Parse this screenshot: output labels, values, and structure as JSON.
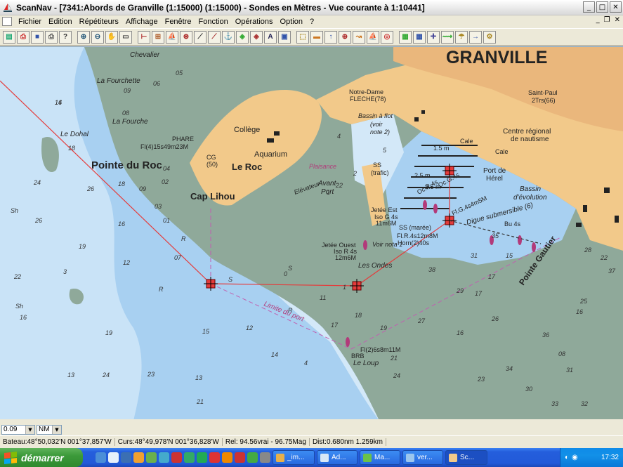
{
  "window": {
    "title": "ScanNav - [7341:Abords de Granville (1:15000) (1:15000) - Sondes en  Mètres  - Vue courante à 1:10441]"
  },
  "window_buttons": [
    "_",
    "□",
    "✕"
  ],
  "menu": [
    "Fichier",
    "Edition",
    "Répétiteurs",
    "Affichage",
    "Fenêtre",
    "Fonction",
    "Opérations",
    "Option",
    "?"
  ],
  "mdi_buttons": [
    "_",
    "❐",
    "✕"
  ],
  "toolbar": [
    "open-icon",
    "print-icon",
    "save-icon",
    "printer-icon",
    "help-pointer-icon",
    "zoom-in-icon",
    "zoom-out-icon",
    "pan-hand-icon",
    "select-rect-icon",
    "ruler-icon",
    "zoom-area-icon",
    "boat-icon",
    "target-icon",
    "route-icon",
    "edit-route-icon",
    "anchor-icon",
    "mark-icon",
    "mark-edit-icon",
    "text-icon",
    "layers-icon",
    "gps-icon",
    "nmea-icon",
    "up-arrow-icon",
    "compass-icon",
    "route-follow-icon",
    "boat-mark-icon",
    "lifebuoy-icon",
    "chart-index-icon",
    "chart-grid-icon",
    "position-icon",
    "track-icon",
    "weather-icon",
    "arrow-right-icon",
    "autopilot-icon"
  ],
  "chart": {
    "place_labels": {
      "granville": "GRANVILLE",
      "pointe_du_roc": "Pointe du Roc",
      "cap_lihou": "Cap Lihou",
      "le_roc": "Le Roc",
      "college": "Collège",
      "aquarium": "Aquarium",
      "pointe_gautier": "Pointe Gautier",
      "la_fourchette": "La Fourchette",
      "la_fourche": "La Fourche",
      "chevalier": "Chevalier",
      "le_dohal": "Le Dohal",
      "les_ondes": "Les Ondes",
      "le_loup": "Le Loup",
      "notre_dame": "Notre-Dame",
      "fleche": "FLECHE(78)",
      "saint_paul": "Saint-Paul",
      "saint_paul_2": "2Trs(66)",
      "centre_regional": "Centre régional",
      "de_nautisme": "de nautisme",
      "port_herel": "Port de",
      "port_herel_2": "Hérel",
      "bassin_evolution": "Bassin",
      "bassin_evolution_2": "d'évolution",
      "digue": "Digue submersible (6)",
      "plaisance": "Plaisance",
      "avant_port": "Avant-",
      "avant_port_2": "Port",
      "bassin_a_flot": "Bassin à flot",
      "voir_note": "(voir",
      "voir_note_2": "note 2)",
      "limite_port": "Limite du port",
      "voir_nota": "Voir nota 1",
      "elevateur": "Elévateur",
      "cale": "Cale",
      "cale_2": "Cale",
      "ss_trafic": "SS",
      "ss_trafic_2": "(trafic)",
      "ss_maree": "SS (marée)",
      "phare": "PHARE",
      "cg": "CG",
      "cg_50": "(50)",
      "brb": "BRB"
    },
    "light_labels": {
      "phare_light": "Fl(4)15s49m23M",
      "jetee_est": "Jetée Est",
      "jetee_est_2": "Iso G 4s",
      "jetee_est_3": "11m6M",
      "jetee_ouest": "Jetée Ouest",
      "jetee_ouest_2": "Iso R 4s",
      "jetee_ouest_3": "12m6M",
      "digue_light": "Fl.R.4s12m8M",
      "horn": "Horn(2)40s",
      "flg": "Fl.G.4s4m5M",
      "loup_light": "Fl(2)6s8m11M",
      "oc_r": "Oc.R.4s",
      "oc_g": "Oc.G.4s",
      "bu": "Bu 4s",
      "len_25a": "2.5 m",
      "len_25b": "2.5 m",
      "len_15": "1.5 m"
    },
    "soundings": [
      "16",
      "18",
      "26",
      "24",
      "26",
      "19",
      "16",
      "18",
      "12",
      "16",
      "19",
      "01",
      "09",
      "07",
      "22",
      "24",
      "23",
      "13",
      "4",
      "5",
      "2",
      "1",
      "09",
      "08",
      "06",
      "05",
      "04",
      "02",
      "03",
      "0",
      "3",
      "4",
      "1",
      "15",
      "14",
      "12",
      "11",
      "13",
      "21",
      "23",
      "24",
      "22",
      "21",
      "17",
      "16",
      "17",
      "15",
      "26",
      "16",
      "22",
      "25",
      "08",
      "32",
      "33",
      "31",
      "30",
      "34",
      "36",
      "37",
      "35",
      "38",
      "31",
      "29",
      "28",
      "27",
      "19",
      "18",
      "17",
      "14"
    ],
    "seabed_marks": [
      "Sh",
      "Sh",
      "R",
      "S",
      "R",
      "R",
      "S"
    ]
  },
  "controls": {
    "scale_value": "0.09",
    "units_value": "NM"
  },
  "status": {
    "bateau": "Bateau:48°50,032'N 001°37,857'W",
    "curseur": "Curs:48°49,978'N 001°36,828'W",
    "relevement": "Rel: 94.56vrai - 96.75Mag",
    "distance": "Dist:0.680nm  1.259km"
  },
  "taskbar": {
    "start_label": "démarrer",
    "tasks": [
      "_im...",
      "Ad...",
      "Ma...",
      "ver...",
      "Sc..."
    ],
    "clock": "17:32"
  },
  "colors": {
    "land": "#f2c98a",
    "town": "#eab77c",
    "shallow": "#8fa99a",
    "sea": "#9ec8ee",
    "deep": "#d3e8f8",
    "route": "#e53b3b"
  }
}
